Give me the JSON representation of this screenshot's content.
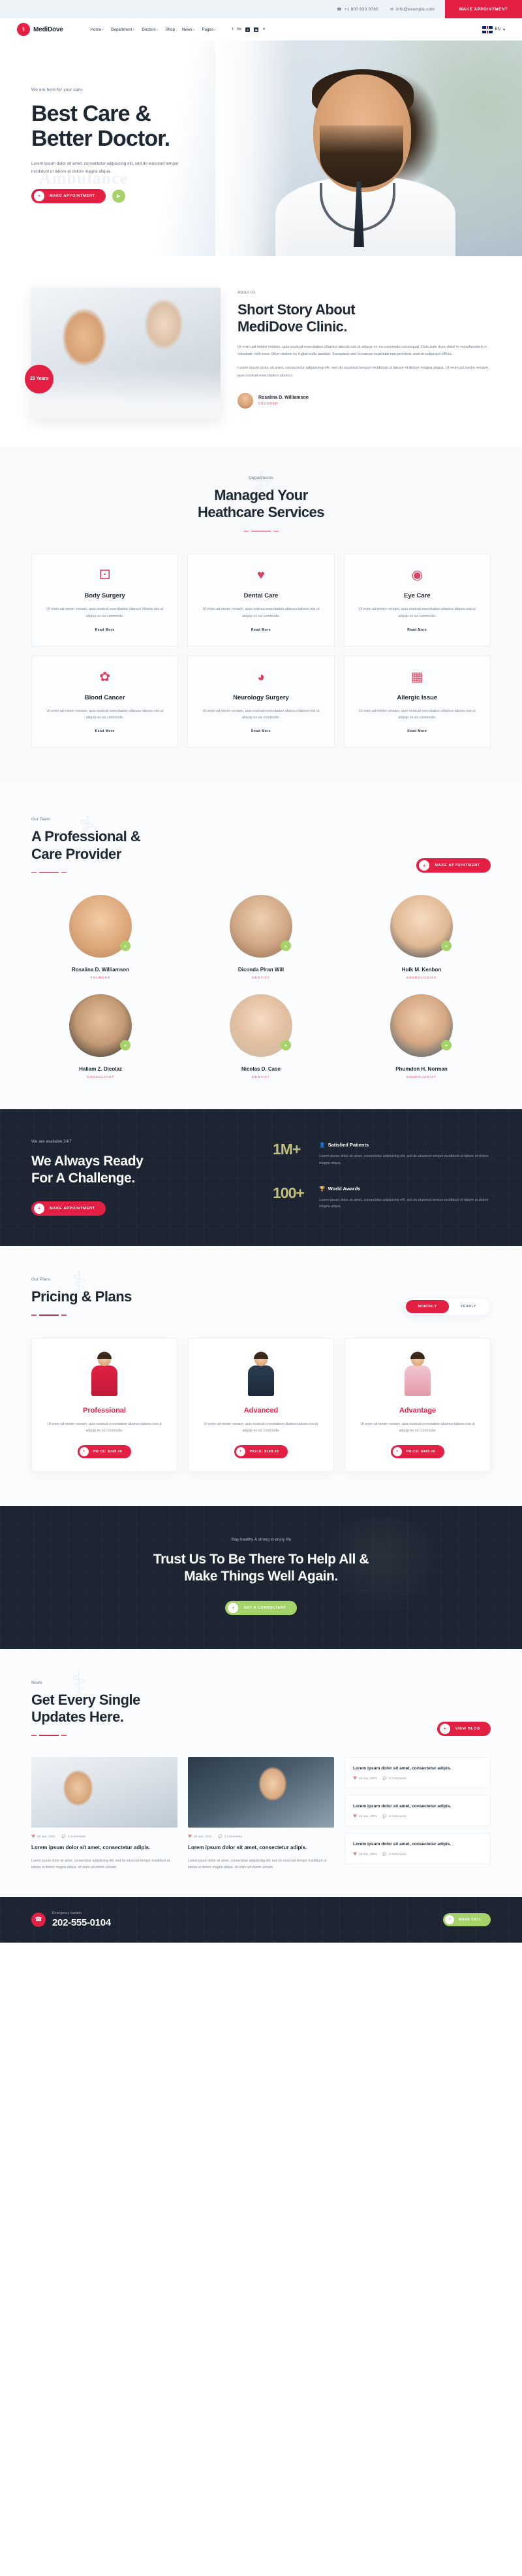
{
  "topbar": {
    "phone": "+1 800 833 9780",
    "email": "info@example.com",
    "phone_icon": "phone-icon",
    "email_icon": "envelope-icon",
    "cta": "MAKE APPOINTMENT"
  },
  "nav": {
    "brand": "MediDove",
    "brand_icon": "medical-cross-dove-icon",
    "items": [
      {
        "label": "Home",
        "caret": "+"
      },
      {
        "label": "Department",
        "caret": "+"
      },
      {
        "label": "Doctors",
        "caret": "+"
      },
      {
        "label": "Shop",
        "caret": ""
      },
      {
        "label": "News",
        "caret": "+"
      },
      {
        "label": "Pages",
        "caret": "+"
      }
    ],
    "social": [
      "facebook-icon",
      "behance-icon",
      "dribbble-icon",
      "instagram-icon",
      "globe-icon"
    ],
    "lang": "EN",
    "lang_caret": "▾"
  },
  "hero": {
    "eyebrow": "We are here for your care.",
    "title_line1": "Best Care &",
    "title_line2": "Better Doctor.",
    "paragraph": "Lorem ipsum dolor sit amet, consectetur adipisicing elit, sed do eiusmod tempor incididunt ut labore et dolore magna aliqua.",
    "button": "MAKE APPOINTMENT",
    "play_icon": "play-icon",
    "watermark": "Ambulance"
  },
  "about": {
    "eyebrow": "About Us",
    "title_line1": "Short Story About",
    "title_line2": "MediDove Clinic.",
    "paragraph1": "Ut enim ad minim veniam, quis nostrud exercitation ullamco laboris nisi ut aliquip ex ea commodo consequat. Duis aute irure dolor in reprehenderit in voluptate velit esse cillum dolore eu fugiat nulla pariatur. Excepteur sint occaecat cupidatat non proident, sunt in culpa qui officia.",
    "paragraph2": "Lorem ipsum dolor sit amet, consectetur adipisicing elit, sed do eiusmod tempor incididunt ut labore et dolore magna aliqua. Ut enim ad minim veniam, quis nostrud exercitation ullamco.",
    "badge": "25 Years",
    "signature_name": "Rosalina D. Williamson",
    "signature_role": "FOUNDER"
  },
  "departments": {
    "eyebrow": "Departments",
    "title_line1": "Managed Your",
    "title_line2": "Heathcare Services",
    "ghost_icon": "nurse-icon",
    "cards": [
      {
        "icon": "body-surgery-icon",
        "title": "Body Surgery",
        "text": "Ut enim ad minim veniam, quis nostrud exercitation ullamco laboris nisi ut aliquip ex ea commodo.",
        "link": "Read More"
      },
      {
        "icon": "tooth-icon",
        "title": "Dental Care",
        "text": "Ut enim ad minim veniam, quis nostrud exercitation ullamco laboris nisi ut aliquip ex ea commodo.",
        "link": "Read More"
      },
      {
        "icon": "eye-icon",
        "title": "Eye Care",
        "text": "Ut enim ad minim veniam, quis nostrud exercitation ullamco laboris nisi ut aliquip ex ea commodo.",
        "link": "Read More"
      },
      {
        "icon": "ribbon-icon",
        "title": "Blood Cancer",
        "text": "Ut enim ad minim veniam, quis nostrud exercitation ullamco laboris nisi ut aliquip ex ea commodo.",
        "link": "Read More"
      },
      {
        "icon": "brain-icon",
        "title": "Neurology Surgery",
        "text": "Ut enim ad minim veniam, quis nostrud exercitation ullamco laboris nisi ut aliquip ex ea commodo.",
        "link": "Read More"
      },
      {
        "icon": "pill-bottle-icon",
        "title": "Allergic Issue",
        "text": "Ut enim ad minim veniam, quis nostrud exercitation ullamco laboris nisi ut aliquip ex ea commodo.",
        "link": "Read More"
      }
    ]
  },
  "team": {
    "eyebrow": "Our Team",
    "title_line1": "A Professional &",
    "title_line2": "Care Provider",
    "cta": "MAKE APPOINTMENT",
    "members": [
      {
        "name": "Rosalina D. Williamson",
        "role": "FOUNDER"
      },
      {
        "name": "Diconda Plran Will",
        "role": "DENTIST"
      },
      {
        "name": "Hulk M. Kenbon",
        "role": "NEUROLOGIST"
      },
      {
        "name": "Haliam Z. Dicolaz",
        "role": "CONSULTANT"
      },
      {
        "name": "Nicolas D. Case",
        "role": "DENTIST"
      },
      {
        "name": "Phumdon H. Norman",
        "role": "NEUROLOGIST"
      }
    ]
  },
  "stats": {
    "eyebrow": "We are available 24/7",
    "title_line1": "We Always Ready",
    "title_line2": "For A Challenge.",
    "button": "MAKE APPOINTMENT",
    "items": [
      {
        "number": "1M+",
        "icon": "user-icon",
        "title": "Satisfied Patients",
        "text": "Lorem ipsum dolor sit amet, consectetur adipisicing elit, sed do eiusmod tempor incididunt ut labore et dolore magna aliqua."
      },
      {
        "number": "100+",
        "icon": "trophy-icon",
        "title": "World Awards",
        "text": "Lorem ipsum dolor sit amet, consectetur adipisicing elit, sed do eiusmod tempor incididunt ut labore et dolore magna aliqua."
      }
    ]
  },
  "pricing": {
    "eyebrow": "Our Plans",
    "title": "Pricing & Plans",
    "toggle_monthly": "MONTHLY",
    "toggle_yearly": "YEARLY",
    "plans": [
      {
        "name": "Professional",
        "text": "Ut enim ad minim veniam, quis nostrud exercitation ullamco laboris nisi ut aliquip ex ea commodo.",
        "button": "PRICE: $249.00"
      },
      {
        "name": "Advanced",
        "text": "Ut enim ad minim veniam, quis nostrud exercitation ullamco laboris nisi ut aliquip ex ea commodo.",
        "button": "PRICE: $349.00"
      },
      {
        "name": "Advantage",
        "text": "Ut enim ad minim veniam, quis nostrud exercitation ullamco laboris nisi ut aliquip ex ea commodo.",
        "button": "PRICE: $449.00"
      }
    ]
  },
  "cta": {
    "eyebrow": "Stay healthy & strong to enjoy life",
    "title_line1": "Trust Us To Be There To Help All &",
    "title_line2": "Make Things Well Again.",
    "button": "GET A CONSULTANT"
  },
  "news": {
    "eyebrow": "News",
    "title_line1": "Get Every Single",
    "title_line2": "Updates Here.",
    "button": "VIEW BLOG",
    "posts": [
      {
        "title": "Lorem ipsum dolor sit amet, consectetur adipis.",
        "date": "26 Jan, 2021",
        "comments": "3 Comments",
        "text": "Lorem ipsum dolor sit amet, consectetur adipisicing elit, sed do eiusmod tempor incididunt ut labore et dolore magna aliqua. Ut enim ad minim veniam."
      },
      {
        "title": "Lorem ipsum dolor sit amet, consectetur adipis.",
        "date": "26 Jan, 2021",
        "comments": "3 Comments",
        "text": "Lorem ipsum dolor sit amet, consectetur adipisicing elit, sed do eiusmod tempor incididunt ut labore et dolore magna aliqua. Ut enim ad minim veniam."
      }
    ],
    "mini_posts": [
      {
        "title": "Lorem ipsum dolor sit amet, consectetur adipis.",
        "date": "26 Jan, 2021",
        "comments": "3 Comments"
      },
      {
        "title": "Lorem ipsum dolor sit amet, consectetur adipis.",
        "date": "26 Jan, 2021",
        "comments": "3 Comments"
      },
      {
        "title": "Lorem ipsum dolor sit amet, consectetur adipis.",
        "date": "26 Jan, 2021",
        "comments": "3 Comments"
      }
    ]
  },
  "callbar": {
    "icon": "phone-icon",
    "label": "Emergency number",
    "number": "202-555-0104",
    "button": "MAKE CALL"
  }
}
